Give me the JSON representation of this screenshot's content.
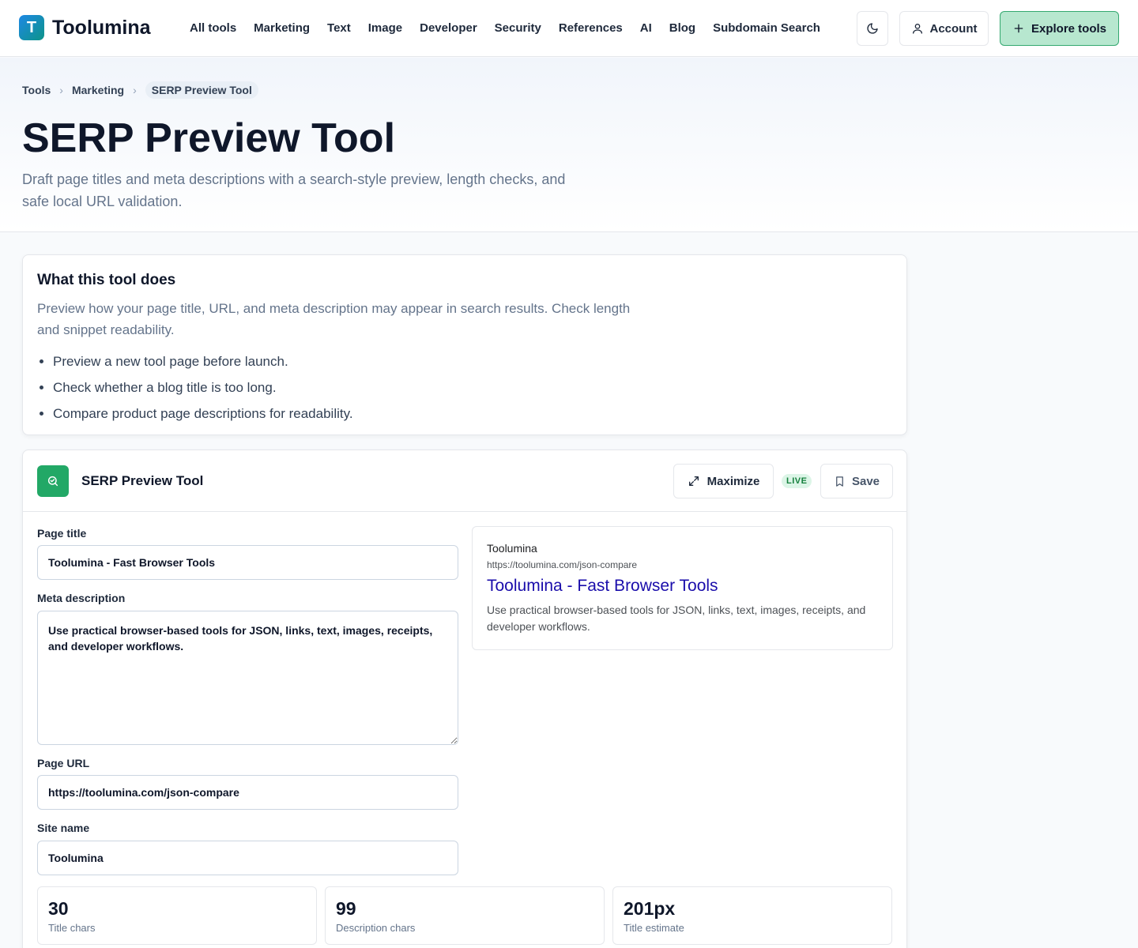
{
  "header": {
    "brand": "Toolumina",
    "logo_letter": "T",
    "nav": [
      "All tools",
      "Marketing",
      "Text",
      "Image",
      "Developer",
      "Security",
      "References",
      "AI",
      "Blog",
      "Subdomain Search"
    ],
    "account_label": "Account",
    "explore_label": "Explore tools"
  },
  "breadcrumb": [
    "Tools",
    "Marketing",
    "SERP Preview Tool"
  ],
  "hero": {
    "title": "SERP Preview Tool",
    "subtitle": "Draft page titles and meta descriptions with a search-style preview, length checks, and safe local URL validation."
  },
  "about": {
    "heading": "What this tool does",
    "description": "Preview how your page title, URL, and meta description may appear in search results. Check length and snippet readability.",
    "bullets": [
      "Preview a new tool page before launch.",
      "Check whether a blog title is too long.",
      "Compare product page descriptions for readability."
    ]
  },
  "tool": {
    "title": "SERP Preview Tool",
    "maximize_label": "Maximize",
    "live_badge": "LIVE",
    "save_label": "Save",
    "fields": {
      "page_title_label": "Page title",
      "page_title_value": "Toolumina - Fast Browser Tools",
      "meta_label": "Meta description",
      "meta_value": "Use practical browser-based tools for JSON, links, text, images, receipts, and developer workflows.",
      "url_label": "Page URL",
      "url_value": "https://toolumina.com/json-compare",
      "site_label": "Site name",
      "site_value": "Toolumina"
    },
    "preview": {
      "site": "Toolumina",
      "url": "https://toolumina.com/json-compare",
      "title": "Toolumina - Fast Browser Tools",
      "description": "Use practical browser-based tools for JSON, links, text, images, receipts, and developer workflows."
    },
    "stats": [
      {
        "value": "30",
        "label": "Title chars"
      },
      {
        "value": "99",
        "label": "Description chars"
      },
      {
        "value": "201px",
        "label": "Title estimate"
      }
    ]
  },
  "colors": {
    "accent_green": "#22a866",
    "explore_bg": "#b7e7cf",
    "serp_link": "#1a0dab"
  }
}
